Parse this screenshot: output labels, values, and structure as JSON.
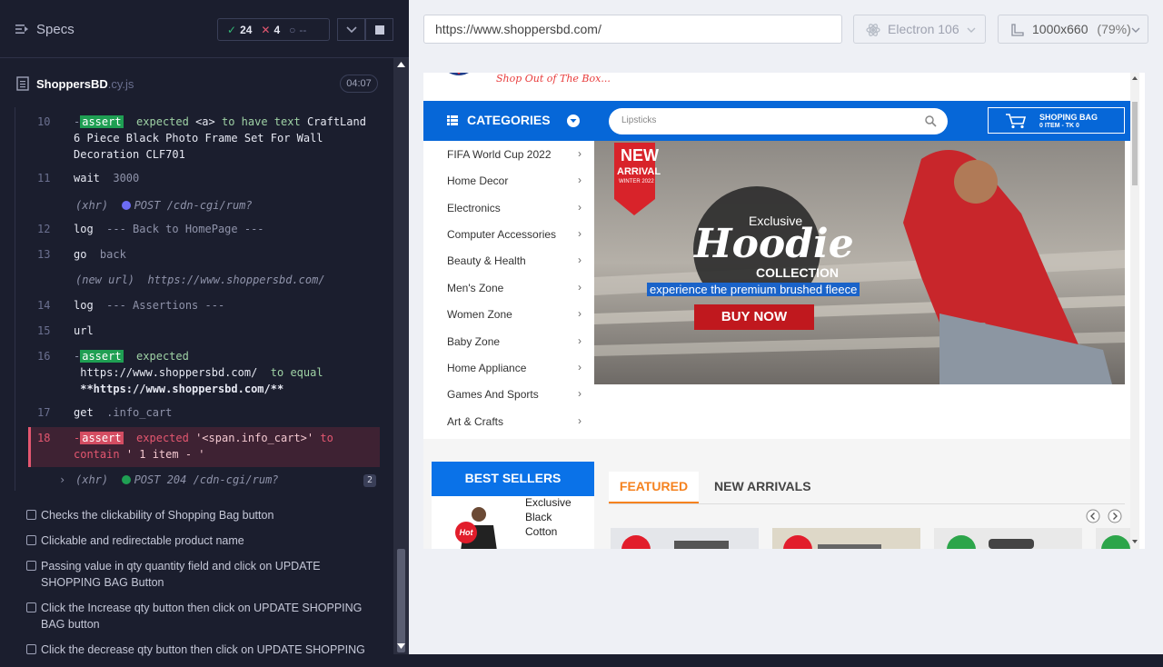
{
  "reporter": {
    "header": {
      "specs_label": "Specs"
    },
    "stats": {
      "passed": "24",
      "failed": "4",
      "pending": "--"
    },
    "spec_file": {
      "name": "ShoppersBD",
      "ext": ".cy.js",
      "duration": "04:07"
    },
    "commands": [
      {
        "num": "10",
        "badge": "assert",
        "text1": "expected",
        "text2": "<a>",
        "text3": "to have text",
        "text4": "CraftLand 6 Piece Black Photo Frame Set For Wall Decoration CLF701"
      },
      {
        "num": "11",
        "name": "wait",
        "arg": "3000"
      },
      {
        "num": "",
        "xhr": "(xhr)",
        "msg": "POST /cdn-cgi/rum?"
      },
      {
        "num": "12",
        "name": "log",
        "arg": "--- Back to HomePage ---"
      },
      {
        "num": "13",
        "name": "go",
        "arg": "back"
      },
      {
        "num": "",
        "newurl": "(new url)",
        "msg": "https://www.shoppersbd.com/"
      },
      {
        "num": "14",
        "name": "log",
        "arg": "--- Assertions ---"
      },
      {
        "num": "15",
        "name": "url",
        "arg": ""
      },
      {
        "num": "16",
        "badge": "assert",
        "text1": "expected",
        "text2": "https://www.shoppersbd.com/",
        "text3": "to equal",
        "text4": "**https://www.shoppersbd.com/**"
      },
      {
        "num": "17",
        "name": "get",
        "arg": ".info_cart"
      },
      {
        "num": "18",
        "badge": "assert",
        "text1": "expected",
        "text2": "'<span.info_cart>'",
        "text3": "to contain",
        "text4": "' 1 item - '"
      },
      {
        "num": "",
        "xhr": "(xhr)",
        "msg": "POST 204 /cdn-cgi/rum?",
        "count": "2"
      }
    ],
    "tests": [
      "Checks the clickability of Shopping Bag button",
      "Clickable and redirectable product name",
      "Passing value in qty quantity field and click on UPDATE SHOPPING BAG Button",
      "Click the Increase qty button then click on UPDATE SHOPPING BAG button",
      "Click the decrease qty button then click on UPDATE SHOPPING"
    ]
  },
  "toolbar": {
    "url": "https://www.shoppersbd.com/",
    "browser": "Electron 106",
    "viewport": "1000x660",
    "scale": "(79%)"
  },
  "site": {
    "tagline": "Shop Out of The Box...",
    "categories_label": "CATEGORIES",
    "search_placeholder": "Lipsticks",
    "bag_title": "SHOPING BAG",
    "bag_info": "0 ITEM - TK 0",
    "categories": [
      "FIFA World Cup 2022",
      "Home Decor",
      "Electronics",
      "Computer Accessories",
      "Beauty & Health",
      "Men's Zone",
      "Women Zone",
      "Baby Zone",
      "Home Appliance",
      "Games And Sports",
      "Art & Crafts"
    ],
    "banner": {
      "sticker_new": "NEW",
      "sticker_arrival": "ARRIVAL",
      "sticker_season": "WINTER 2022",
      "exclusive": "Exclusive",
      "hoodie": "Hoodie",
      "collection": "COLLECTION",
      "tagline": "experience the premium brushed fleece",
      "cta": "BUY NOW"
    },
    "best_sellers_label": "BEST SELLERS",
    "bs_item": {
      "badge": "Hot",
      "name": "Exclusive Black Cotton"
    },
    "tabs": {
      "featured": "FEATURED",
      "new_arrivals": "NEW ARRIVALS"
    },
    "colors": {
      "brand_blue": "#0667d8",
      "accent_orange": "#f5821f",
      "hot_red": "#e21d2b"
    }
  }
}
